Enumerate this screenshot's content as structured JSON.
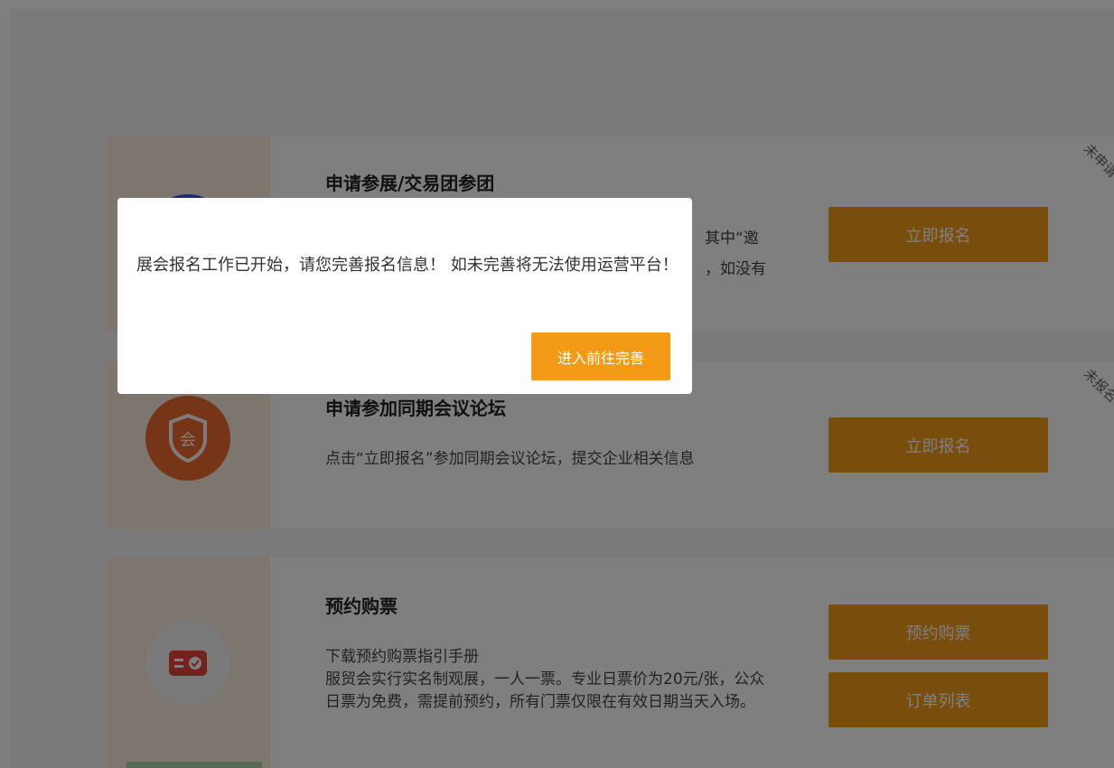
{
  "cards": [
    {
      "title": "申请参展/交易团参团",
      "desc": "其中“邀\n，如没有",
      "button": "立即报名",
      "tag": "未申请",
      "icon": "blue-circle-icon"
    },
    {
      "title": "申请参加同期会议论坛",
      "desc": "点击“立即报名”参加同期会议论坛，提交企业相关信息",
      "button": "立即报名",
      "tag": "未报名",
      "icon": "shield-meeting-icon",
      "icon_label": "会"
    },
    {
      "title": "预约购票",
      "desc_link": "下载预约购票指引手册",
      "desc": "服贸会实行实名制观展，一人一票。专业日票价为20元/张，公众日票为免费，需提前预约，所有门票仅限在有效日期当天入场。",
      "buttons": [
        "预约购票",
        "订单列表"
      ],
      "icon": "ticket-icon"
    }
  ],
  "dialog": {
    "message": "展会报名工作已开始，请您完善报名信息！ 如未完善将无法使用运营平台！",
    "button": "进入前往完善"
  },
  "colors": {
    "accent": "#f39b16",
    "card_side": "#f8ecdd",
    "blue_icon": "#3a5ce0",
    "orange_icon": "#ee6a2e",
    "red_icon": "#e8453c"
  }
}
